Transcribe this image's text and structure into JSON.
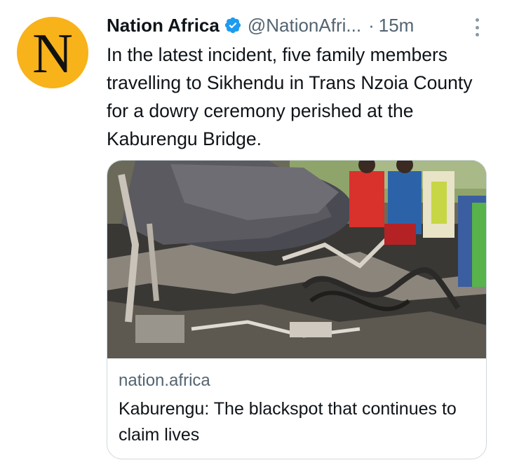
{
  "tweet": {
    "avatar_letter": "N",
    "display_name": "Nation Africa",
    "handle": "@NationAfri...",
    "separator": "·",
    "time": "15m",
    "text": "In the latest incident, five family members travelling to Sikhendu in Trans Nzoia County for a dowry ceremony perished at the Kaburengu Bridge."
  },
  "card": {
    "domain": "nation.africa",
    "title": "Kaburengu: The blackspot that continues to claim lives"
  },
  "colors": {
    "avatar_bg": "#f8b21a",
    "verified": "#1d9bf0",
    "secondary_text": "#536471",
    "card_border": "#cfd9de"
  },
  "icons": {
    "verified": "verified-badge-icon",
    "more": "more-options-icon"
  }
}
